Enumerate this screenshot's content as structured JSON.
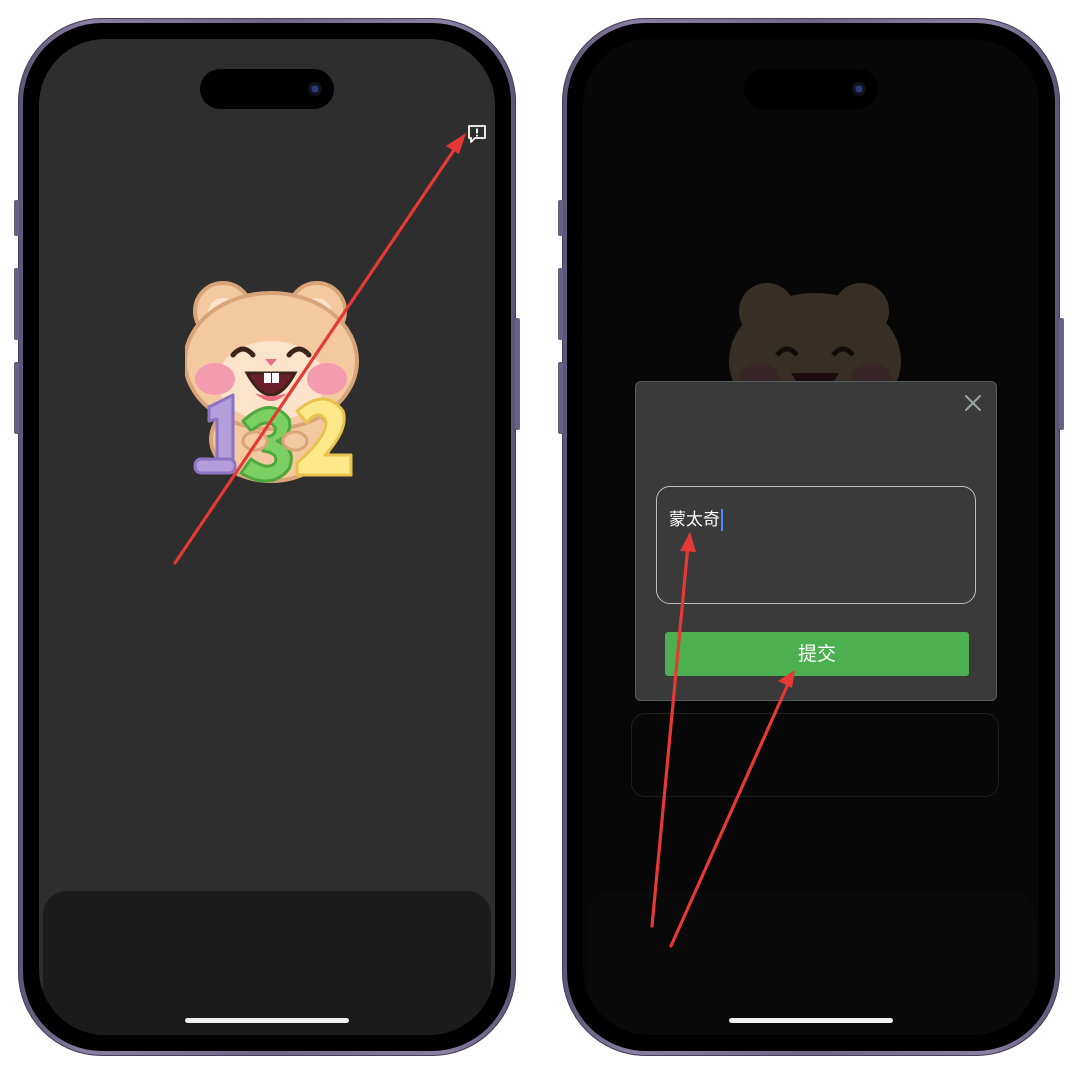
{
  "left_screen": {
    "icons": {
      "report": "report-feedback-icon",
      "sticker": "hamster-sticker-icon"
    }
  },
  "right_screen": {
    "dialog": {
      "input_value": "蒙太奇",
      "submit_label": "提交",
      "close_icon": "close-icon"
    }
  },
  "colors": {
    "left_screen_bg": "#2e2e2e",
    "right_screen_bg": "#070707",
    "dialog_bg": "#3a3a3a",
    "submit_green": "#4caf50",
    "caret_blue": "#3d8bff",
    "annotation_red": "#e53935",
    "phone_frame": "#6f6589"
  }
}
